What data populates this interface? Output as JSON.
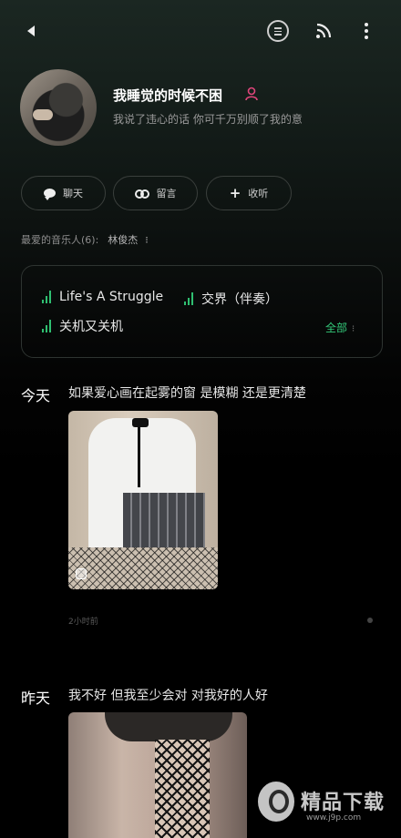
{
  "header": {
    "back_icon": "back-arrow-icon",
    "menu_icon": "list-circle-icon",
    "share_icon": "broadcast-icon",
    "more_icon": "more-vertical-icon"
  },
  "profile": {
    "username": "我睡觉的时候不困",
    "bio": "我说了违心的话 你可千万别顺了我的意",
    "gender_icon_color": "#e0457b"
  },
  "actions": [
    {
      "label": "聊天",
      "icon": "chat-bubble-icon"
    },
    {
      "label": "留言",
      "icon": "voicemail-icon"
    },
    {
      "label": "收听",
      "icon": "plus-icon"
    }
  ],
  "favorite": {
    "label": "最爱的音乐人(6):",
    "artist": "林俊杰",
    "more": "⁝"
  },
  "songs": {
    "items": [
      "Life's A Struggle",
      "交界（伴奏）",
      "关机又关机"
    ],
    "all_label": "全部",
    "accent_color": "#2fbf71"
  },
  "feed": [
    {
      "day": "今天",
      "text": "如果爱心画在起雾的窗 是模糊 还是更清楚",
      "time": "2小时前"
    },
    {
      "day": "昨天",
      "text": "我不好 但我至少会对 对我好的人好"
    }
  ],
  "watermark": {
    "brand": "精品下载",
    "url": "www.j9p.com"
  }
}
